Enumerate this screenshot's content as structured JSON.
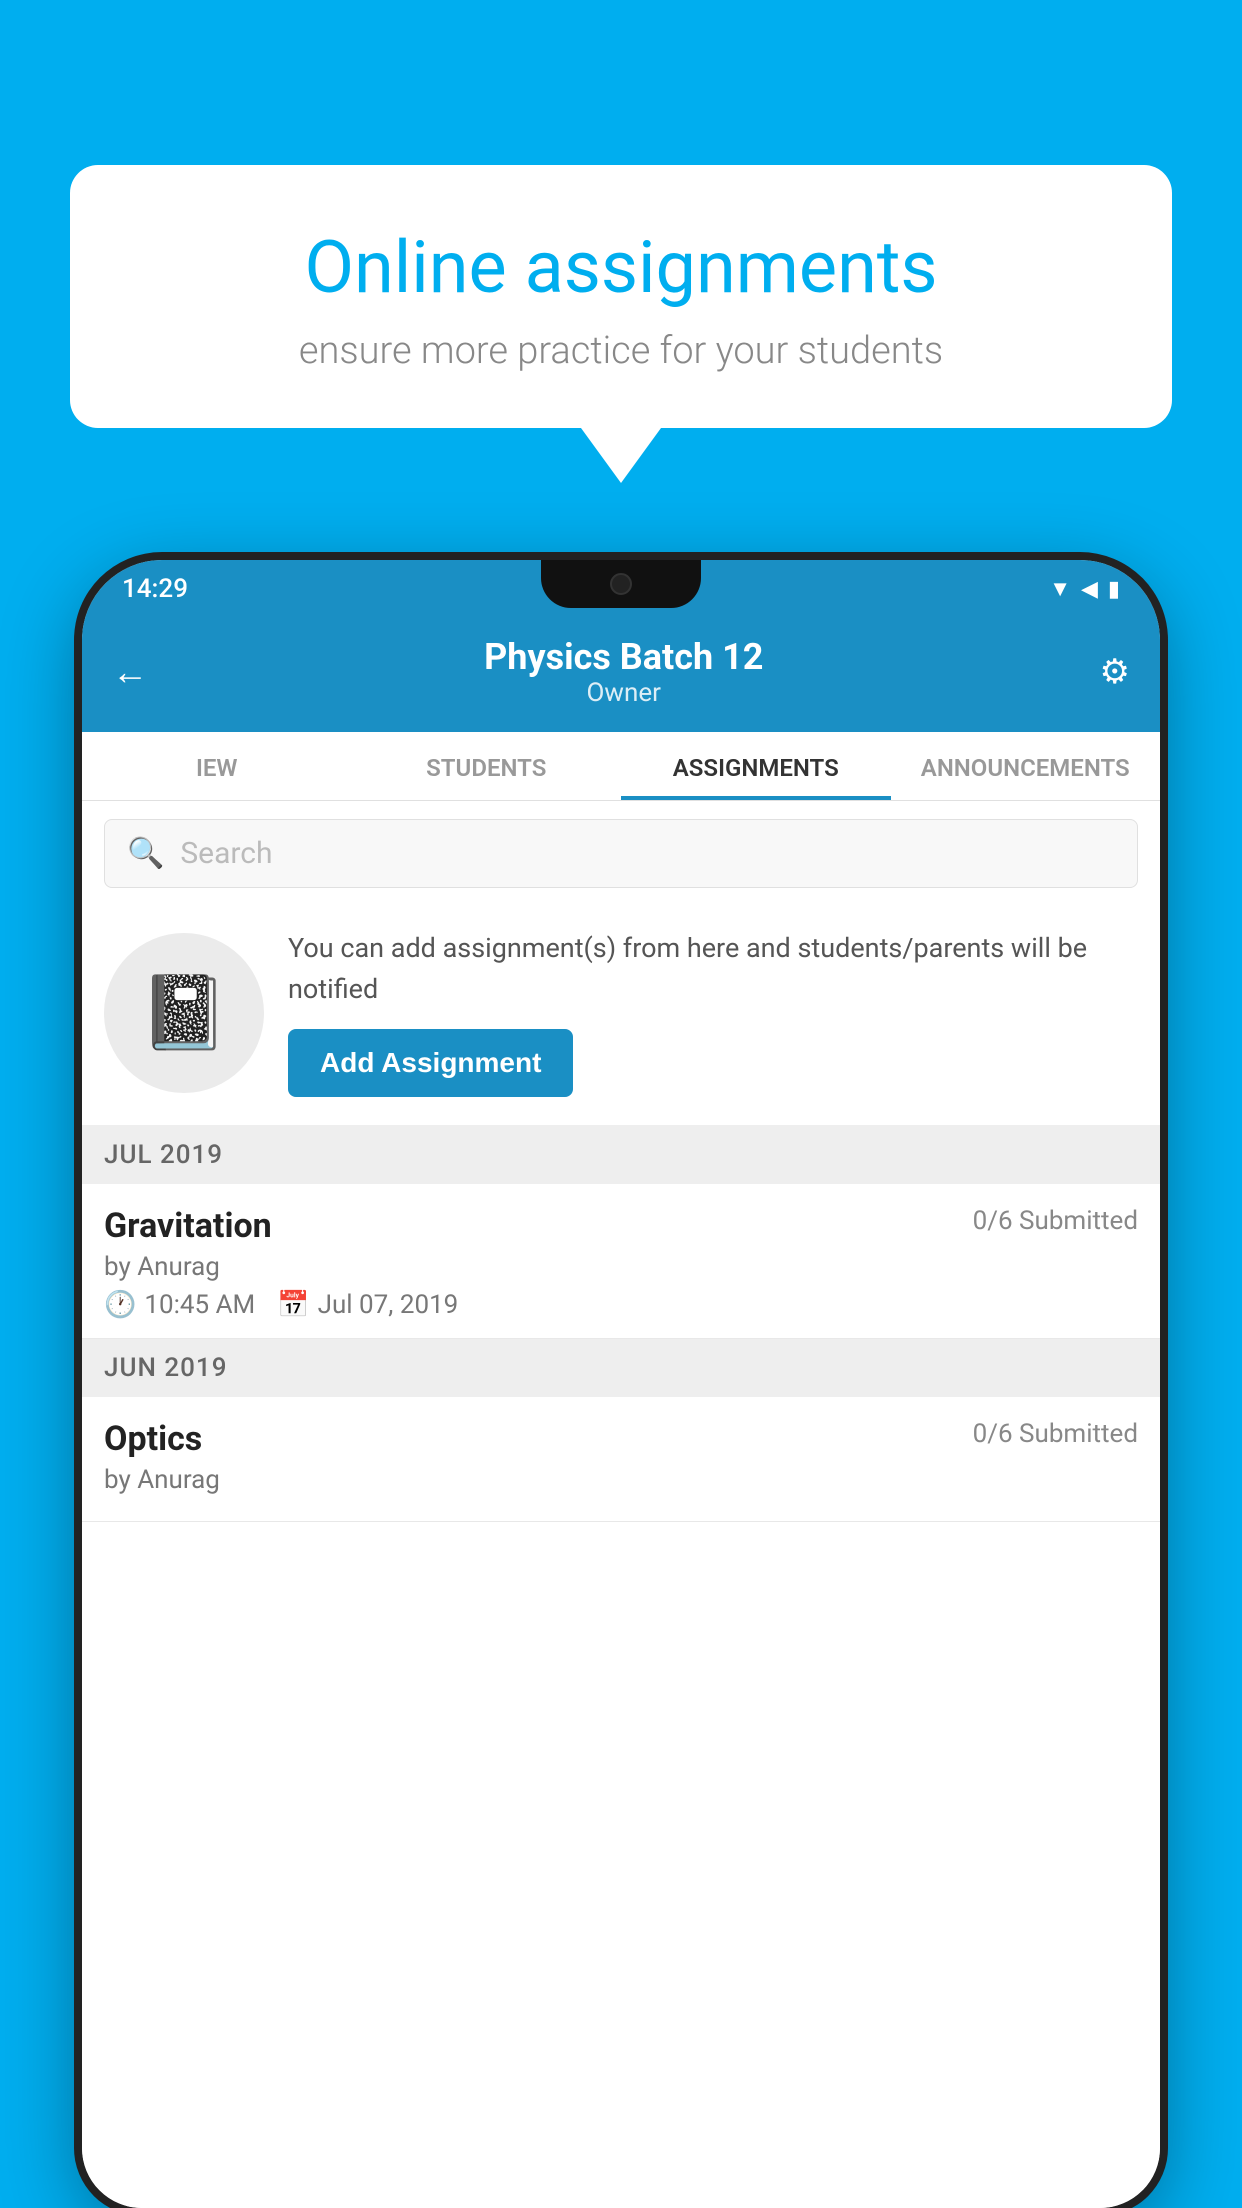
{
  "background": {
    "color": "#00AEEF"
  },
  "speech_bubble": {
    "title": "Online assignments",
    "subtitle": "ensure more practice for your students"
  },
  "status_bar": {
    "time": "14:29",
    "icons": [
      "▼",
      "◀",
      "▮"
    ]
  },
  "app_header": {
    "back_label": "←",
    "title": "Physics Batch 12",
    "subtitle": "Owner",
    "settings_label": "⚙"
  },
  "tabs": [
    {
      "label": "IEW",
      "active": false
    },
    {
      "label": "STUDENTS",
      "active": false
    },
    {
      "label": "ASSIGNMENTS",
      "active": true
    },
    {
      "label": "ANNOUNCEMENTS",
      "active": false
    }
  ],
  "search": {
    "placeholder": "Search"
  },
  "promo": {
    "description": "You can add assignment(s) from here and students/parents will be notified",
    "button_label": "Add Assignment"
  },
  "sections": [
    {
      "label": "JUL 2019",
      "assignments": [
        {
          "name": "Gravitation",
          "submitted": "0/6 Submitted",
          "author": "by Anurag",
          "time": "10:45 AM",
          "date": "Jul 07, 2019"
        }
      ]
    },
    {
      "label": "JUN 2019",
      "assignments": [
        {
          "name": "Optics",
          "submitted": "0/6 Submitted",
          "author": "by Anurag",
          "time": "",
          "date": ""
        }
      ]
    }
  ]
}
